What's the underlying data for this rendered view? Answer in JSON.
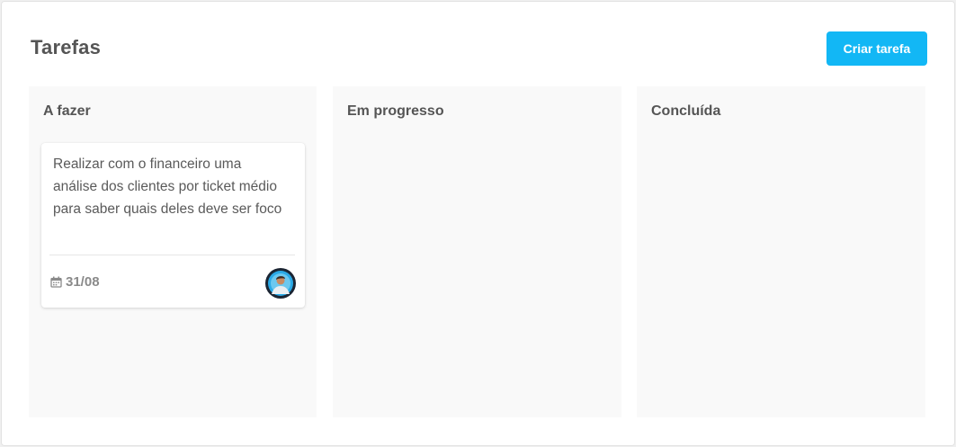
{
  "header": {
    "title": "Tarefas",
    "create_label": "Criar tarefa"
  },
  "columns": [
    {
      "title": "A fazer",
      "cards": [
        {
          "text": "Realizar com o financeiro uma análise dos clientes por ticket médio para saber quais deles deve ser foco",
          "due": "31/08",
          "due_icon": "calendar-icon",
          "assignee_icon": "avatar"
        }
      ]
    },
    {
      "title": "Em progresso",
      "cards": []
    },
    {
      "title": "Concluída",
      "cards": []
    }
  ],
  "colors": {
    "accent": "#12b7f5",
    "column_bg": "#f9f9f9",
    "text": "#555555"
  }
}
